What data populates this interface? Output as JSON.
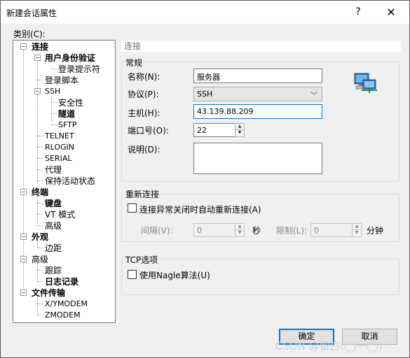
{
  "window": {
    "title": "新建会话属性",
    "help": "?",
    "close": "✕"
  },
  "category_label": "类别(C):",
  "tree": {
    "connection": "连接",
    "auth": "用户身份验证",
    "login_prompt": "登录提示符",
    "login_script": "登录脚本",
    "ssh": "SSH",
    "security": "安全性",
    "tunnel": "隧道",
    "sftp": "SFTP",
    "telnet": "TELNET",
    "rlogin": "RLOGIN",
    "serial": "SERIAL",
    "proxy": "代理",
    "keepalive": "保持活动状态",
    "terminal": "终端",
    "keyboard": "键盘",
    "vt_mode": "VT 模式",
    "advanced1": "高级",
    "appearance": "外观",
    "margin": "边距",
    "advanced2": "高级",
    "trace": "跟踪",
    "logging": "日志记录",
    "file_transfer": "文件传输",
    "xymodem": "X/YMODEM",
    "zmodem": "ZMODEM"
  },
  "panel": {
    "header": "连接",
    "general": {
      "title": "常规",
      "name_label": "名称(N):",
      "name_value": "服务器",
      "protocol_label": "协议(P):",
      "protocol_value": "SSH",
      "host_label": "主机(H):",
      "host_value": "43.139.88.209",
      "port_label": "端口号(O):",
      "port_value": "22",
      "desc_label": "说明(D):",
      "desc_value": ""
    },
    "reconnect": {
      "title": "重新连接",
      "checkbox_label": "连接异常关闭时自动重新连接(A)",
      "interval_label": "间隔(V):",
      "interval_value": "0",
      "seconds": "秒",
      "limit_label": "限制(L):",
      "limit_value": "0",
      "minutes": "分钟"
    },
    "tcp": {
      "title": "TCP选项",
      "nagle_label": "使用Nagle算法(U)"
    }
  },
  "buttons": {
    "ok": "确定",
    "cancel": "取消"
  },
  "watermark": "CSDN @留白(◯一◯)"
}
